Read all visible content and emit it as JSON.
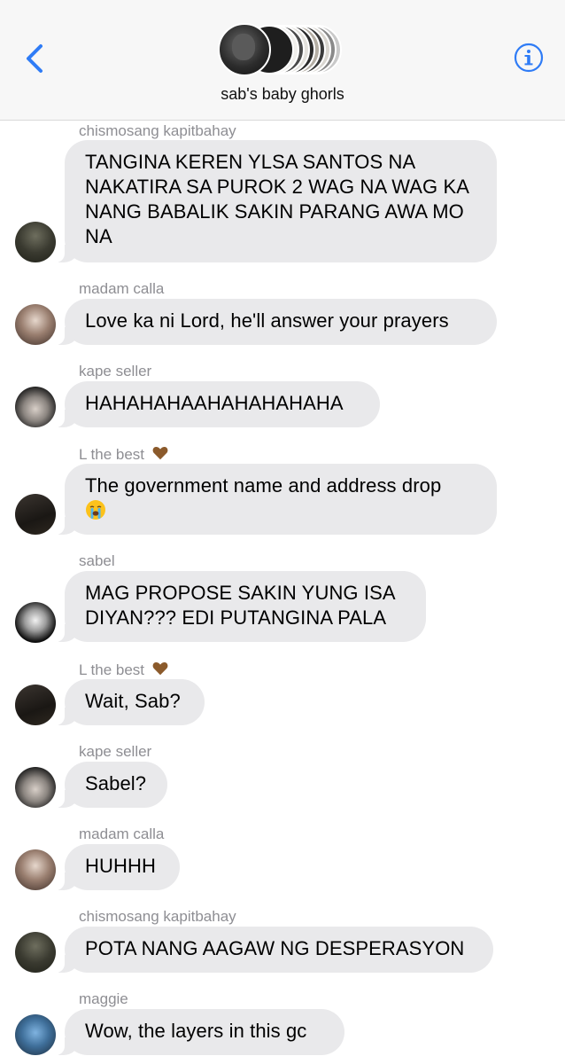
{
  "header": {
    "group_name": "sab's baby ghorls",
    "back_icon": "chevron-left-icon",
    "info_icon": "info-circle-icon",
    "accent_color": "#2f7cf6"
  },
  "messages": [
    {
      "sender": "chismosang kapitbahay",
      "text": "TANGINA KEREN YLSA SANTOS NA NAKATIRA SA PUROK 2 WAG NA WAG KA NANG BABALIK SAKIN PARANG AWA MO NA",
      "avatar": "avatar-chismosang-kapitbahay"
    },
    {
      "sender": "madam calla",
      "text": "Love ka ni Lord, he'll answer your prayers",
      "avatar": "avatar-madam-calla"
    },
    {
      "sender": "kape seller",
      "text": "HAHAHAHAAHAHAHAHAHA",
      "avatar": "avatar-kape-seller"
    },
    {
      "sender": "L the best",
      "sender_emoji": "brown-heart-icon",
      "text": "The government name and address drop",
      "text_emoji": "loudly-crying-face-icon",
      "avatar": "avatar-l-the-best"
    },
    {
      "sender": "sabel",
      "text": "MAG PROPOSE SAKIN YUNG ISA DIYAN??? EDI PUTANGINA PALA",
      "avatar": "avatar-sabel"
    },
    {
      "sender": "L the best",
      "sender_emoji": "brown-heart-icon",
      "text": "Wait, Sab?",
      "avatar": "avatar-l-the-best"
    },
    {
      "sender": "kape seller",
      "text": "Sabel?",
      "avatar": "avatar-kape-seller"
    },
    {
      "sender": "madam calla",
      "text": "HUHHH",
      "avatar": "avatar-madam-calla"
    },
    {
      "sender": "chismosang kapitbahay",
      "text": "POTA NANG AAGAW NG DESPERASYON",
      "avatar": "avatar-chismosang-kapitbahay"
    },
    {
      "sender": "maggie",
      "text": "Wow, the layers in this gc",
      "avatar": "avatar-maggie"
    }
  ]
}
